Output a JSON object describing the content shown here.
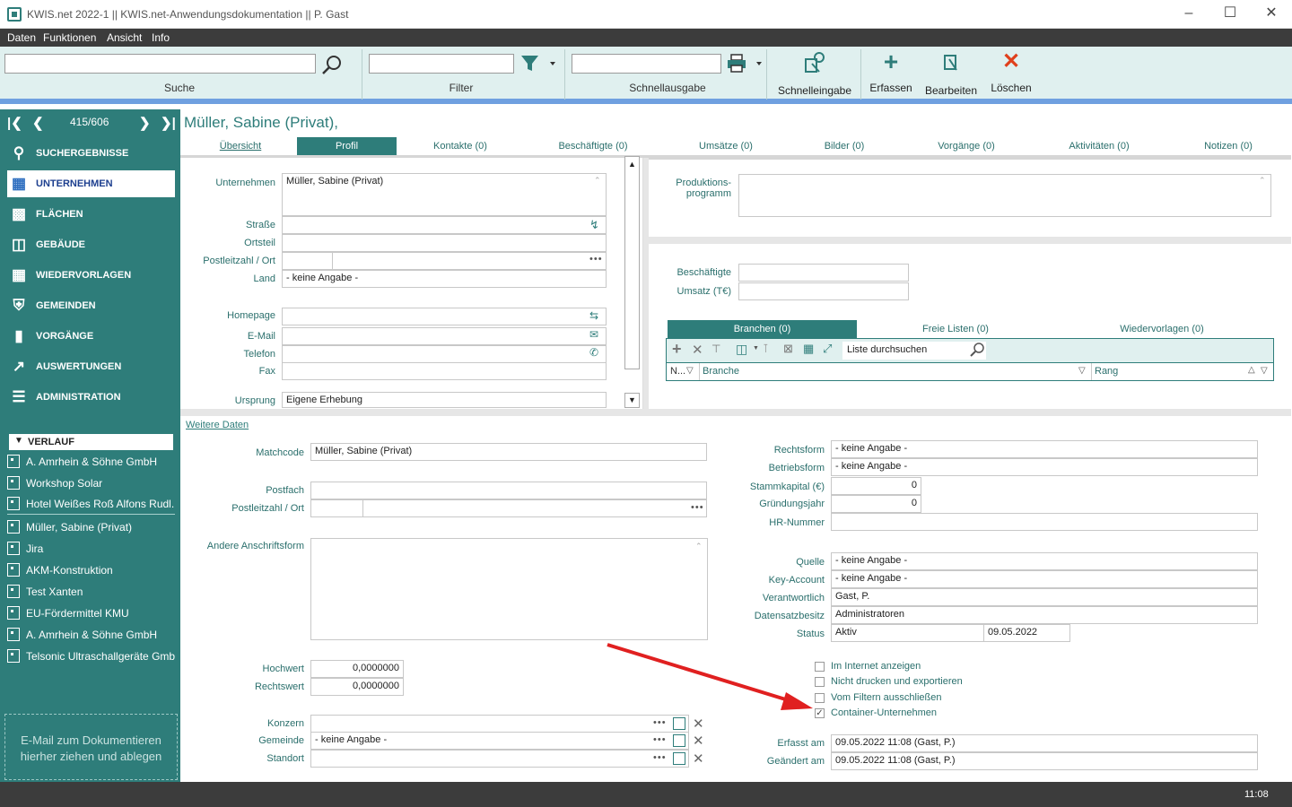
{
  "window": {
    "title": "KWIS.net 2022-1 || KWIS.net-Anwendungsdokumentation || P. Gast"
  },
  "menu": [
    "Daten",
    "Funktionen",
    "Ansicht",
    "Info"
  ],
  "toolbar": {
    "search_label": "Suche",
    "filter_label": "Filter",
    "quick_output_label": "Schnellausgabe",
    "quick_entry_label": "Schnelleingabe",
    "create_label": "Erfassen",
    "edit_label": "Bearbeiten",
    "delete_label": "Löschen"
  },
  "sidebar": {
    "record_counter": "415/606",
    "nav": [
      {
        "label": "SUCHERGEBNISSE",
        "icon": "search-icon"
      },
      {
        "label": "UNTERNEHMEN",
        "icon": "company-icon",
        "active": true
      },
      {
        "label": "FLÄCHEN",
        "icon": "areas-icon"
      },
      {
        "label": "GEBÄUDE",
        "icon": "building-icon"
      },
      {
        "label": "WIEDERVORLAGEN",
        "icon": "reminder-icon"
      },
      {
        "label": "GEMEINDEN",
        "icon": "shield-icon"
      },
      {
        "label": "VORGÄNGE",
        "icon": "folder-icon"
      },
      {
        "label": "AUSWERTUNGEN",
        "icon": "chart-icon"
      },
      {
        "label": "ADMINISTRATION",
        "icon": "settings-icon"
      }
    ],
    "history_title": "VERLAUF",
    "history": [
      "A. Amrhein & Söhne GmbH",
      "Workshop Solar",
      "Hotel Weißes Roß Alfons Rudl...",
      "Müller, Sabine (Privat)",
      "Jira",
      "AKM-Konstruktion",
      "Test Xanten",
      "EU-Fördermittel KMU",
      "A. Amrhein & Söhne GmbH",
      "Telsonic Ultraschallgeräte Gmb..."
    ],
    "dropzone": "E-Mail  zum Dokumentieren hierher ziehen und ablegen"
  },
  "record": {
    "title": "Müller, Sabine (Privat),",
    "tabs": [
      "Übersicht",
      "Profil",
      "Kontakte (0)",
      "Beschäftigte (0)",
      "Umsätze (0)",
      "Bilder (0)",
      "Vorgänge (0)",
      "Aktivitäten (0)",
      "Notizen (0)"
    ],
    "active_tab": "Profil"
  },
  "profile": {
    "company_label": "Unternehmen",
    "company_value": "Müller, Sabine (Privat)",
    "street_label": "Straße",
    "district_label": "Ortsteil",
    "zip_city_label": "Postleitzahl / Ort",
    "country_label": "Land",
    "country_value": "- keine Angabe -",
    "homepage_label": "Homepage",
    "email_label": "E-Mail",
    "phone_label": "Telefon",
    "fax_label": "Fax",
    "origin_label": "Ursprung",
    "origin_value": "Eigene Erhebung",
    "production_label_1": "Produktions-",
    "production_label_2": "programm",
    "employees_label": "Beschäftigte",
    "revenue_label": "Umsatz (T€)",
    "subtabs": [
      "Branchen (0)",
      "Freie Listen (0)",
      "Wiedervorlagen (0)"
    ],
    "list_search_placeholder": "Liste durchsuchen",
    "grid_columns": [
      "N...",
      "Branche",
      "Rang"
    ]
  },
  "more": {
    "link": "Weitere Daten",
    "matchcode_label": "Matchcode",
    "matchcode_value": "Müller, Sabine (Privat)",
    "pobox_label": "Postfach",
    "zip_city_label": "Postleitzahl / Ort",
    "other_address_label": "Andere Anschriftsform",
    "hochwert_label": "Hochwert",
    "hochwert_value": "0,0000000",
    "rechtswert_label": "Rechtswert",
    "rechtswert_value": "0,0000000",
    "group_label": "Konzern",
    "municipality_label": "Gemeinde",
    "municipality_value": "- keine Angabe -",
    "location_label": "Standort",
    "legal_form_label": "Rechtsform",
    "legal_form_value": "- keine Angabe -",
    "business_form_label": "Betriebsform",
    "business_form_value": "- keine Angabe -",
    "capital_label": "Stammkapital (€)",
    "capital_value": "0",
    "founding_label": "Gründungsjahr",
    "founding_value": "0",
    "hr_label": "HR-Nummer",
    "source_label": "Quelle",
    "source_value": "- keine Angabe -",
    "key_account_label": "Key-Account",
    "key_account_value": "- keine Angabe -",
    "responsible_label": "Verantwortlich",
    "responsible_value": "Gast, P.",
    "owner_label": "Datensatzbesitz",
    "owner_value": "Administratoren",
    "status_label": "Status",
    "status_value": "Aktiv",
    "status_date": "09.05.2022",
    "checkboxes": [
      {
        "label": "Im Internet anzeigen",
        "checked": false
      },
      {
        "label": "Nicht drucken und exportieren",
        "checked": false
      },
      {
        "label": "Vom Filtern ausschließen",
        "checked": false
      },
      {
        "label": "Container-Unternehmen",
        "checked": true
      }
    ],
    "created_label": "Erfasst am",
    "created_value": "09.05.2022 11:08 (Gast, P.)",
    "changed_label": "Geändert am",
    "changed_value": "09.05.2022 11:08 (Gast, P.)"
  },
  "status": {
    "time": "11:08"
  },
  "colors": {
    "teal": "#2e7d7a",
    "arrow": "#e02020",
    "toolbar_bg": "#e0f0ef"
  }
}
